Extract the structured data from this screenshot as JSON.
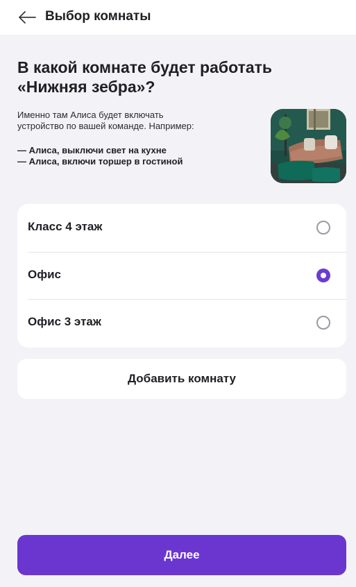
{
  "header": {
    "back_icon": "arrow-left-icon",
    "title": "Выбор комнаты"
  },
  "intro": {
    "title_line1": "В какой комнате будет работать",
    "title_line2": "«Нижняя зебра»?",
    "desc_line1": "Именно там Алиса будет включать",
    "desc_line2": "устройство по вашей команде. Например:",
    "example1": "— Алиса, выключи свет на кухне",
    "example2": "— Алиса, включи торшер в гостиной"
  },
  "rooms": [
    {
      "label": "Класс 4 этаж",
      "selected": false
    },
    {
      "label": "Офис",
      "selected": true
    },
    {
      "label": "Офис 3 этаж",
      "selected": false
    }
  ],
  "add_room_label": "Добавить комнату",
  "next_label": "Далее",
  "colors": {
    "accent": "#6a36cf",
    "background": "#f3f2f7"
  }
}
